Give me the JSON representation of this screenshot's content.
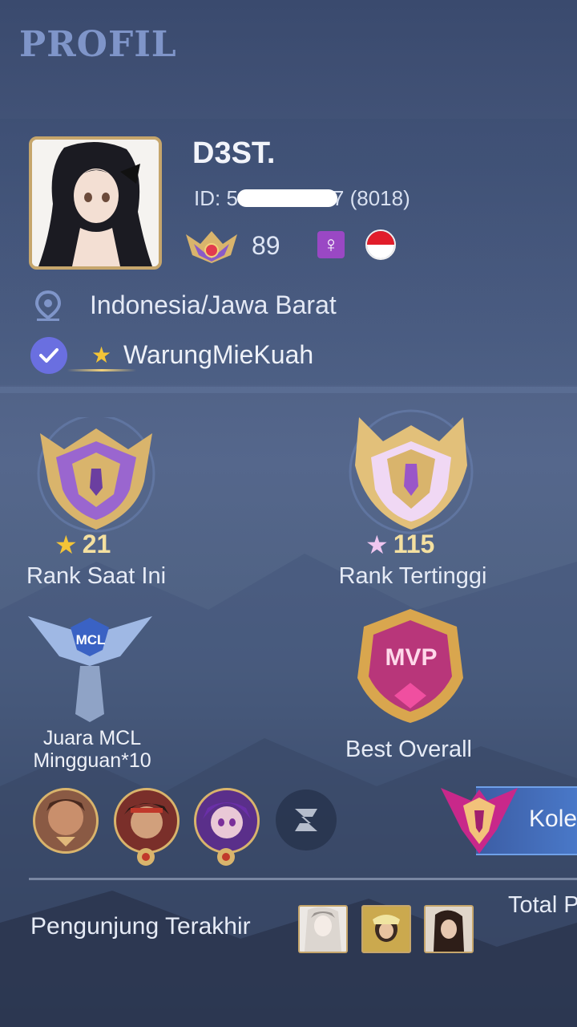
{
  "header": {
    "title": "PROFIL"
  },
  "profile": {
    "username": "D3ST.",
    "id_text": "ID: 5",
    "id_suffix": "7 (8018)",
    "level": "89",
    "location": "Indonesia/Jawa Barat",
    "squad": "WarungMieKuah",
    "gender_symbol": "♀"
  },
  "ranks": {
    "current": {
      "stars": "21",
      "label": "Rank Saat Ini"
    },
    "highest": {
      "stars": "115",
      "label": "Rank Tertinggi"
    }
  },
  "achievements": {
    "mcl": {
      "badge_text": "MCL",
      "label_line1": "Juara MCL",
      "label_line2": "Mingguan*10"
    },
    "best": {
      "badge_text": "MVP",
      "label": "Best Overall"
    }
  },
  "collection": {
    "label": "Kole"
  },
  "visitors": {
    "label": "Pengunjung Terakhir",
    "total_label": "Total P"
  },
  "colors": {
    "accent_gold": "#d9b46c",
    "title_blue": "#7f95c9",
    "gender_purple": "#9a48c4",
    "verified": "#6a6fe0",
    "flag_red": "#e11d2a"
  },
  "icons": [
    "location-pin-icon",
    "verified-check-icon",
    "star-icon",
    "gender-female-icon",
    "flag-indonesia-icon",
    "z-icon"
  ]
}
